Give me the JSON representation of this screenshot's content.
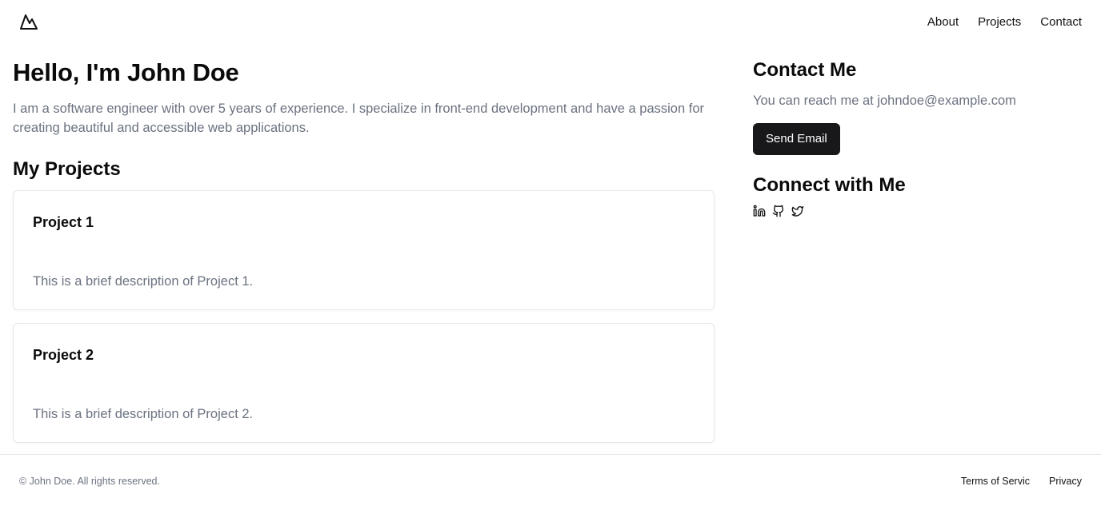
{
  "header": {
    "logo_icon": "mountain-icon",
    "nav": {
      "about": "About",
      "projects": "Projects",
      "contact": "Contact"
    }
  },
  "hero": {
    "title": "Hello, I'm John Doe",
    "text": "I am a software engineer with over 5 years of experience. I specialize in front-end development and have a passion for creating beautiful and accessible web applications."
  },
  "projects": {
    "title": "My Projects",
    "items": [
      {
        "title": "Project 1",
        "description": "This is a brief description of Project 1."
      },
      {
        "title": "Project 2",
        "description": "This is a brief description of Project 2."
      }
    ]
  },
  "contact": {
    "title": "Contact Me",
    "text": "You can reach me at johndoe@example.com",
    "button_label": "Send Email"
  },
  "connect": {
    "title": "Connect with Me",
    "icons": [
      "linkedin-icon",
      "github-icon",
      "twitter-icon"
    ]
  },
  "footer": {
    "copyright": "© John Doe. All rights reserved.",
    "terms": "Terms of Servic",
    "privacy": "Privacy"
  },
  "colors": {
    "button_bg": "#18181b",
    "muted_text": "#6b7280",
    "border": "#e5e7eb"
  }
}
